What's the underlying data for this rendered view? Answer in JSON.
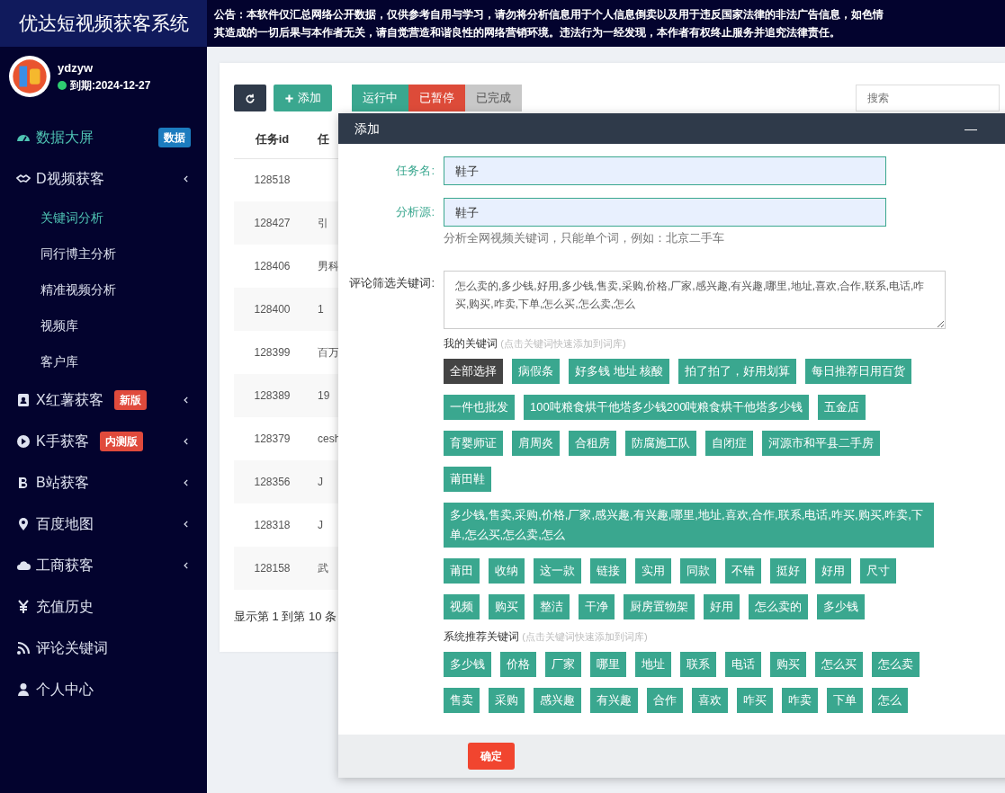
{
  "app_title": "优达短视频获客系统",
  "notice": [
    "公告：本软件仅汇总网络公开数据，仅供参考自用与学习，请勿将分析信息用于个人信息倒卖以及用于违反国家法律的非法广告信息，如色情",
    "其造成的一切后果与本作者无关，请自觉营造和谐良性的网络营销环境。违法行为一经发现，本作者有权终止服务并追究法律责任。"
  ],
  "user": {
    "name": "ydzyw",
    "expiry": "到期:2024-12-27",
    "online": true
  },
  "sidebar": {
    "items": [
      {
        "label": "数据大屏",
        "selected": true,
        "collapsible": false,
        "badge": {
          "text": "数据",
          "color": "#1c7cbf"
        }
      },
      {
        "label": "D视频获客",
        "selected": false,
        "collapsible": true,
        "children": [
          {
            "label": "关键词分析",
            "selected": true
          },
          {
            "label": "同行博主分析",
            "selected": false
          },
          {
            "label": "精准视频分析",
            "selected": false
          },
          {
            "label": "视频库",
            "selected": false
          },
          {
            "label": "客户库",
            "selected": false
          }
        ]
      },
      {
        "label": "X红薯获客",
        "selected": false,
        "collapsible": true,
        "badge": {
          "text": "新版",
          "color": "#e04a3c"
        }
      },
      {
        "label": "K手获客",
        "selected": false,
        "collapsible": true,
        "badge": {
          "text": "内测版",
          "color": "#e04a3c"
        }
      },
      {
        "label": "B站获客",
        "selected": false,
        "collapsible": true
      },
      {
        "label": "百度地图",
        "selected": false,
        "collapsible": true
      },
      {
        "label": "工商获客",
        "selected": false,
        "collapsible": true
      },
      {
        "label": "充值历史",
        "selected": false,
        "collapsible": false
      },
      {
        "label": "评论关键词",
        "selected": false,
        "collapsible": false
      },
      {
        "label": "个人中心",
        "selected": false,
        "collapsible": false
      }
    ]
  },
  "toolbar": {
    "buttons": [
      {
        "kind": "refresh"
      },
      {
        "kind": "add",
        "label": "添加"
      }
    ],
    "filters": [
      {
        "label": "运行中",
        "color": "#3aa78f",
        "disabled": false
      },
      {
        "label": "已暂停",
        "color": "#dd4b39",
        "disabled": false
      },
      {
        "label": "已完成",
        "color": "#c8c8c8",
        "disabled": true
      }
    ]
  },
  "search": {
    "placeholder": "搜索"
  },
  "table": {
    "columns": [
      "任务id",
      "任"
    ],
    "rows": [
      [
        "128518"
      ],
      [
        "128427",
        "引"
      ],
      [
        "128406",
        "男科"
      ],
      [
        "128400",
        "1"
      ],
      [
        "128399",
        "百万"
      ],
      [
        "128389",
        "19"
      ],
      [
        "128379",
        "cesh"
      ],
      [
        "128356",
        "J"
      ],
      [
        "128318",
        "J"
      ],
      [
        "128158",
        "武"
      ]
    ]
  },
  "table_footer": "显示第 1 到第 10 条",
  "modal": {
    "title": "添加",
    "minimize": "—",
    "fields": [
      {
        "label": "任务名:",
        "value": "鞋子",
        "highlighted": true
      },
      {
        "label": "分析源:",
        "value": "鞋子",
        "highlighted": true,
        "help": "分析全网视频关键词，只能单个词，例如：北京二手车"
      }
    ],
    "comment_filter": {
      "label": "评论筛选关键词:",
      "value": "怎么卖的,多少钱,好用,多少钱,售卖,采购,价格,厂家,感兴趣,有兴趣,哪里,地址,喜欢,合作,联系,电话,咋买,购买,咋卖,下单,怎么买,怎么卖,怎么",
      "highlighted": false
    },
    "keyword_groups": [
      {
        "title": "我的关键词",
        "hint": "(点击关键词快速添加到词库)",
        "tags": [
          {
            "label": "全部选择",
            "kind": "select_all"
          },
          {
            "label": "病假条",
            "kind": "keyword"
          },
          {
            "label": "好多钱 地址 核酸",
            "kind": "keyword"
          },
          {
            "label": "拍了拍了，好用划算",
            "kind": "keyword"
          },
          {
            "label": "每日推荐日用百货",
            "kind": "keyword"
          },
          {
            "label": "一件也批发",
            "kind": "keyword"
          },
          {
            "label": "100吨粮食烘干他塔多少钱200吨粮食烘干他塔多少钱",
            "kind": "keyword"
          },
          {
            "label": "五金店",
            "kind": "keyword"
          },
          {
            "label": "育婴师证",
            "kind": "keyword"
          },
          {
            "label": "肩周炎",
            "kind": "keyword"
          },
          {
            "label": "合租房",
            "kind": "keyword"
          },
          {
            "label": "防腐施工队",
            "kind": "keyword"
          },
          {
            "label": "自闭症",
            "kind": "keyword"
          },
          {
            "label": "河源市和平县二手房",
            "kind": "keyword"
          },
          {
            "label": "莆田鞋",
            "kind": "keyword"
          },
          {
            "label": "多少钱,售卖,采购,价格,厂家,感兴趣,有兴趣,哪里,地址,喜欢,合作,联系,电话,咋买,购买,咋卖,下单,怎么买,怎么卖,怎么",
            "kind": "keyword"
          },
          {
            "label": "莆田",
            "kind": "keyword"
          },
          {
            "label": "收纳",
            "kind": "keyword"
          },
          {
            "label": "这一款",
            "kind": "keyword"
          },
          {
            "label": "链接",
            "kind": "keyword"
          },
          {
            "label": "实用",
            "kind": "keyword"
          },
          {
            "label": "同款",
            "kind": "keyword"
          },
          {
            "label": "不错",
            "kind": "keyword"
          },
          {
            "label": "挺好",
            "kind": "keyword"
          },
          {
            "label": "好用",
            "kind": "keyword"
          },
          {
            "label": "尺寸",
            "kind": "keyword"
          },
          {
            "label": "视频",
            "kind": "keyword"
          },
          {
            "label": "购买",
            "kind": "keyword"
          },
          {
            "label": "整洁",
            "kind": "keyword"
          },
          {
            "label": "干净",
            "kind": "keyword"
          },
          {
            "label": "厨房置物架",
            "kind": "keyword"
          },
          {
            "label": "好用",
            "kind": "keyword"
          },
          {
            "label": "怎么卖的",
            "kind": "keyword"
          },
          {
            "label": "多少钱",
            "kind": "keyword"
          }
        ]
      },
      {
        "title": "系统推荐关键词",
        "hint": "(点击关键词快速添加到词库)",
        "tags": [
          {
            "label": "多少钱",
            "kind": "keyword"
          },
          {
            "label": "价格",
            "kind": "keyword"
          },
          {
            "label": "厂家",
            "kind": "keyword"
          },
          {
            "label": "哪里",
            "kind": "keyword"
          },
          {
            "label": "地址",
            "kind": "keyword"
          },
          {
            "label": "联系",
            "kind": "keyword"
          },
          {
            "label": "电话",
            "kind": "keyword"
          },
          {
            "label": "购买",
            "kind": "keyword"
          },
          {
            "label": "怎么买",
            "kind": "keyword"
          },
          {
            "label": "怎么卖",
            "kind": "keyword"
          },
          {
            "label": "售卖",
            "kind": "keyword"
          },
          {
            "label": "采购",
            "kind": "keyword"
          },
          {
            "label": "感兴趣",
            "kind": "keyword"
          },
          {
            "label": "有兴趣",
            "kind": "keyword"
          },
          {
            "label": "合作",
            "kind": "keyword"
          },
          {
            "label": "喜欢",
            "kind": "keyword"
          },
          {
            "label": "咋买",
            "kind": "keyword"
          },
          {
            "label": "咋卖",
            "kind": "keyword"
          },
          {
            "label": "下单",
            "kind": "keyword"
          },
          {
            "label": "怎么",
            "kind": "keyword"
          }
        ]
      }
    ],
    "confirm": "确定"
  }
}
